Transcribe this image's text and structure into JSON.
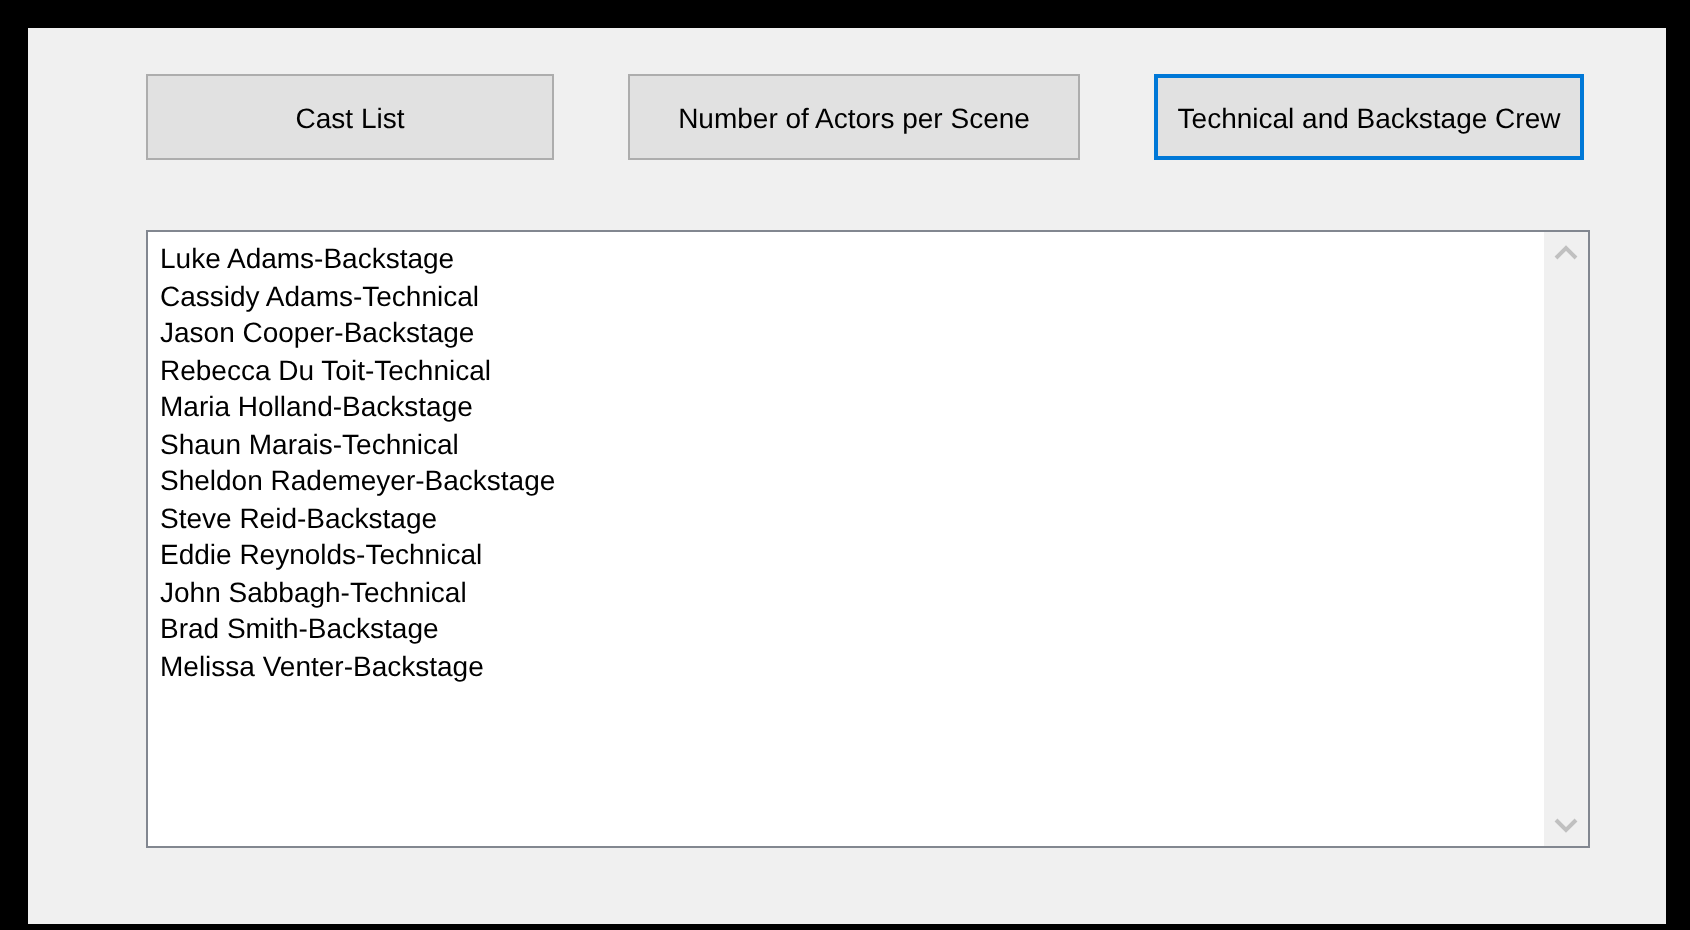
{
  "buttons": [
    {
      "label": "Cast List",
      "focused": false
    },
    {
      "label": "Number of Actors per Scene",
      "focused": false
    },
    {
      "label": "Technical and Backstage Crew",
      "focused": true
    }
  ],
  "list": {
    "items": [
      "Luke Adams-Backstage",
      "Cassidy Adams-Technical",
      "Jason Cooper-Backstage",
      "Rebecca Du Toit-Technical",
      "Maria Holland-Backstage",
      "Shaun Marais-Technical",
      "Sheldon Rademeyer-Backstage",
      "Steve Reid-Backstage",
      "Eddie Reynolds-Technical",
      "John Sabbagh-Technical",
      "Brad Smith-Backstage",
      "Melissa Venter-Backstage"
    ]
  }
}
